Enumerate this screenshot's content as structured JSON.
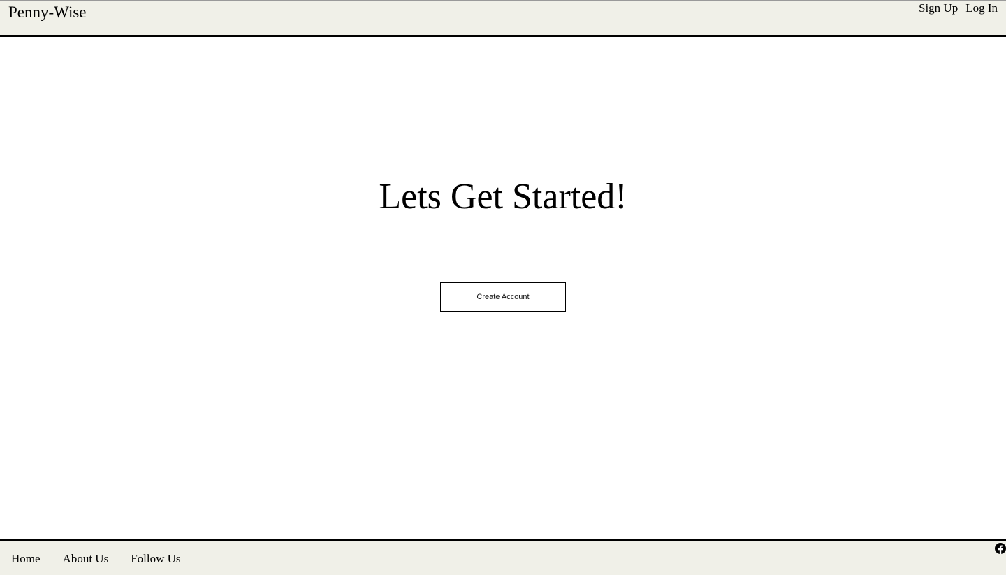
{
  "header": {
    "brand": "Penny-Wise",
    "links": [
      {
        "label": "Sign Up"
      },
      {
        "label": "Log In"
      }
    ]
  },
  "main": {
    "title": "Lets Get Started!",
    "cta_label": "Create Account"
  },
  "footer": {
    "links": [
      {
        "label": "Home"
      },
      {
        "label": "About Us"
      },
      {
        "label": "Follow Us"
      }
    ],
    "social_icon": "facebook-icon"
  },
  "colors": {
    "bar_background": "#f0f0e8",
    "page_background": "#ffffff",
    "border": "#000000"
  }
}
